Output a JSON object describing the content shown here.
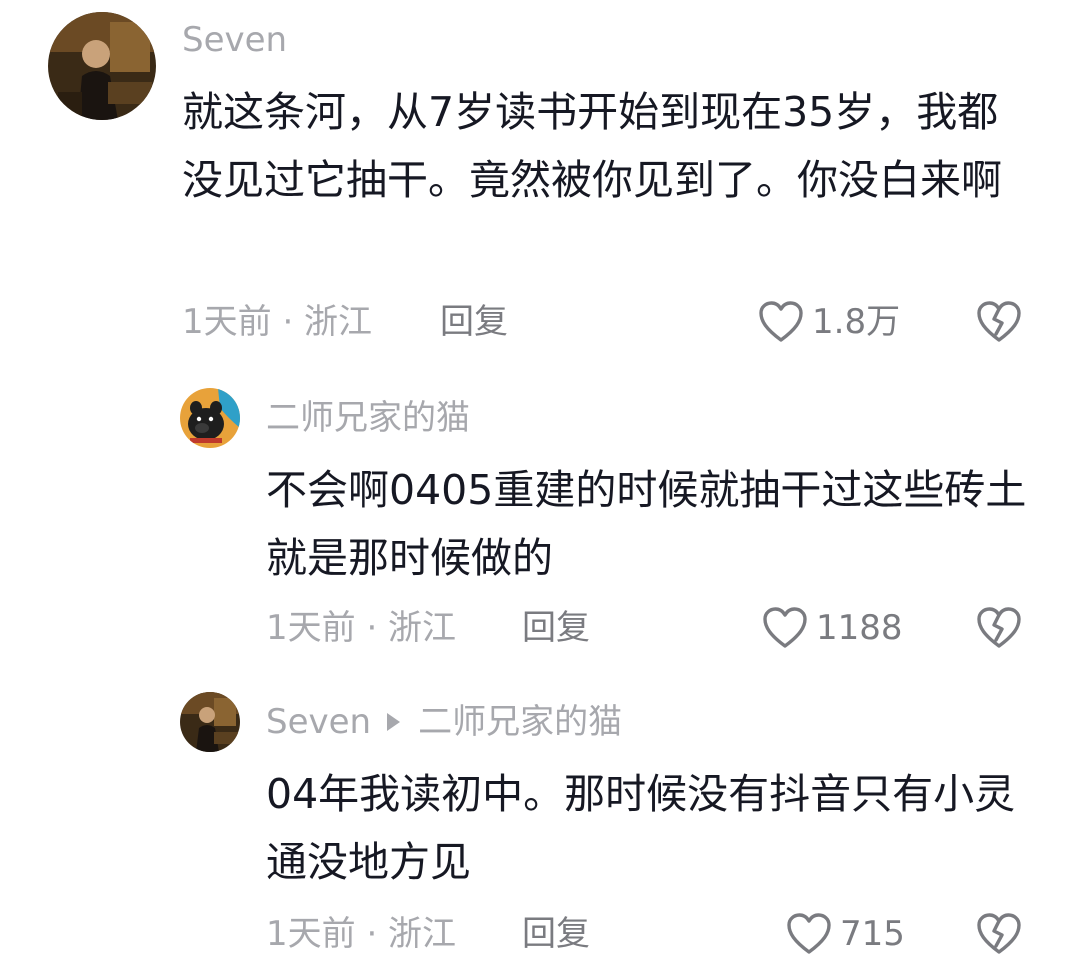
{
  "comments": [
    {
      "username": "Seven",
      "text": "就这条河，从7岁读书开始到现在35岁，我都没见过它抽干。竟然被你见到了。你没白来啊",
      "meta": "1天前 · 浙江",
      "reply_label": "回复",
      "likes": "1.8万",
      "avatar_icon": "user-photo-icon"
    },
    {
      "username": "二师兄家的猫",
      "text": "不会啊0405重建的时候就抽干过这些砖土就是那时候做的",
      "meta": "1天前 · 浙江",
      "reply_label": "回复",
      "likes": "1188",
      "avatar_icon": "cartoon-pig-icon"
    },
    {
      "username": "Seven",
      "reply_to": "二师兄家的猫",
      "text": "04年我读初中。那时候没有抖音只有小灵通没地方见",
      "meta": "1天前 · 浙江",
      "reply_label": "回复",
      "likes": "715",
      "avatar_icon": "user-photo-icon"
    }
  ],
  "icons": {
    "like": "heart-outline-icon",
    "dislike": "broken-heart-icon"
  },
  "colors": {
    "text": "#161823",
    "muted": "#a7a8ad",
    "action": "#7a7b80"
  }
}
